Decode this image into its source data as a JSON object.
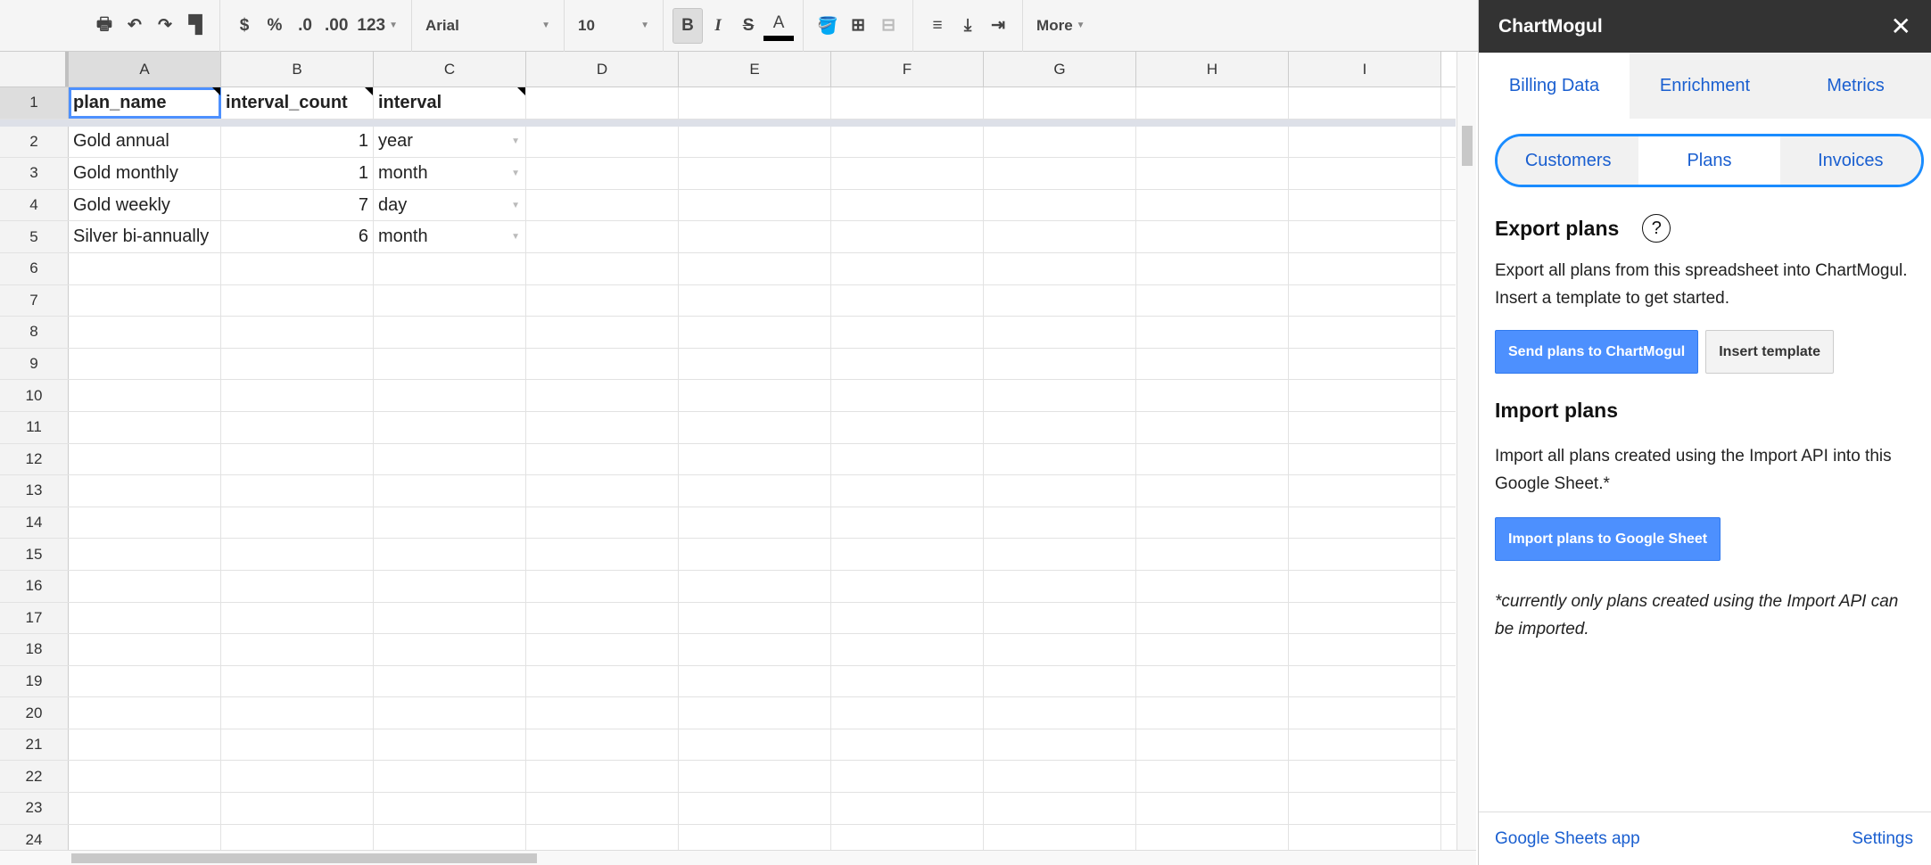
{
  "toolbar": {
    "currency": "$",
    "percent": "%",
    "dec_less": ".0",
    "dec_more": ".00",
    "format": "123",
    "font": "Arial",
    "size": "10",
    "bold": "B",
    "italic": "I",
    "strike": "S",
    "text_color": "A",
    "more": "More"
  },
  "columns": [
    "A",
    "B",
    "C",
    "D",
    "E",
    "F",
    "G",
    "H",
    "I"
  ],
  "rows": [
    [
      "plan_name",
      "interval_count",
      "interval"
    ],
    [
      "Gold annual",
      "1",
      "year"
    ],
    [
      "Gold monthly",
      "1",
      "month"
    ],
    [
      "Gold weekly",
      "7",
      "day"
    ],
    [
      "Silver bi-annually",
      "6",
      "month"
    ]
  ],
  "row_numbers": [
    "1",
    "2",
    "3",
    "4",
    "5",
    "6",
    "7",
    "8",
    "9",
    "10",
    "11",
    "12",
    "13",
    "14",
    "15",
    "16",
    "17",
    "18",
    "19",
    "20",
    "21",
    "22",
    "23",
    "24"
  ],
  "sidebar": {
    "title": "ChartMogul",
    "close": "✕",
    "tabs": [
      "Billing Data",
      "Enrichment",
      "Metrics"
    ],
    "subtabs": [
      "Customers",
      "Plans",
      "Invoices"
    ],
    "export_title": "Export plans",
    "help": "?",
    "export_text": "Export all plans from this spreadsheet into ChartMogul. Insert a template to get started.",
    "send_button": "Send plans to ChartMogul",
    "template_button": "Insert template",
    "import_title": "Import plans",
    "import_text": "Import all plans created using the Import API into this Google Sheet.*",
    "import_button": "Import plans to Google Sheet",
    "note": "*currently only plans created using the Import API can be imported.",
    "footer_left": "Google Sheets app",
    "footer_right": "Settings"
  }
}
